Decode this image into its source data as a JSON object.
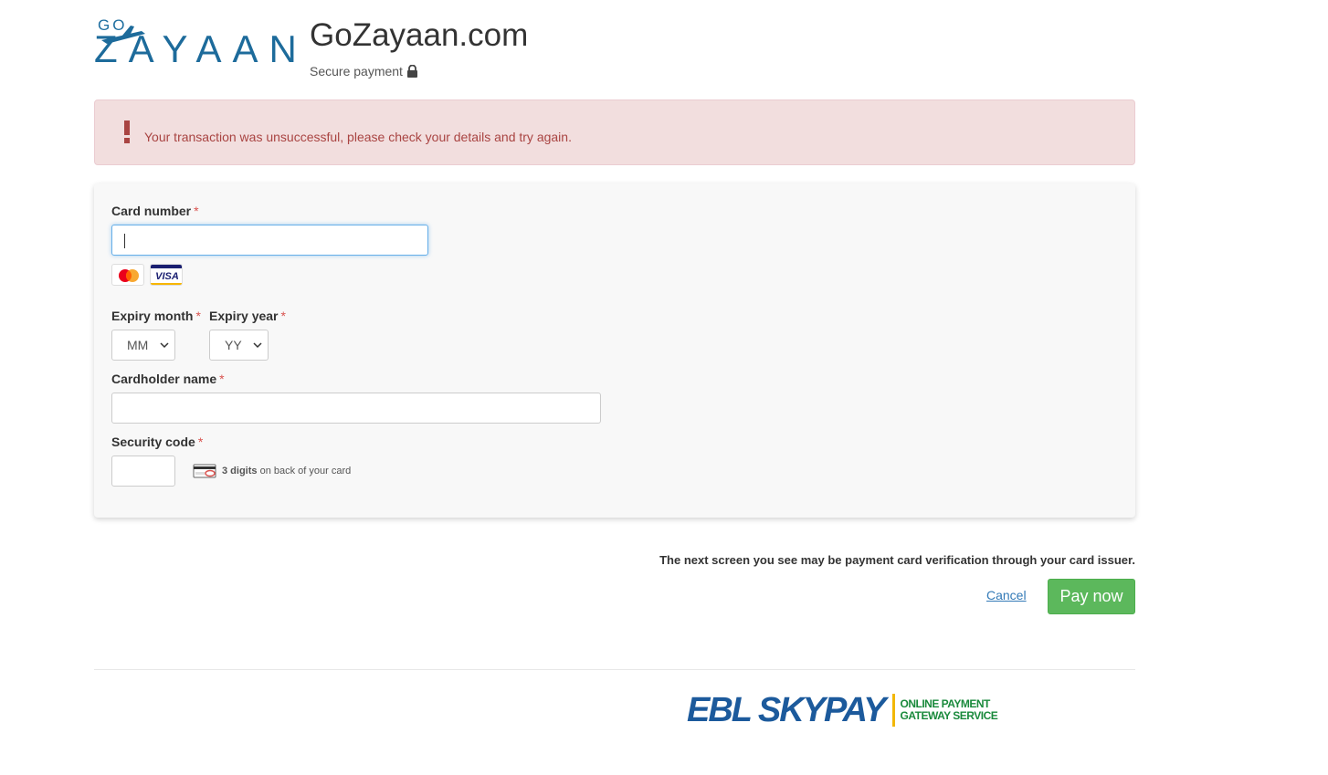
{
  "header": {
    "logo_small": "GO",
    "logo_word": "ZAYAAN",
    "site_title": "GoZayaan.com",
    "secure_label": "Secure payment"
  },
  "alert": {
    "icon": "exclamation-icon",
    "message": "Your transaction was unsuccessful, please check your details and try again.",
    "color": "#a94442"
  },
  "form": {
    "card_number": {
      "label": "Card number",
      "value": ""
    },
    "accepted_cards": [
      "mastercard-icon",
      "visa-icon"
    ],
    "visa_text": "VISA",
    "expiry_month": {
      "label": "Expiry month",
      "selected": "MM"
    },
    "expiry_year": {
      "label": "Expiry year",
      "selected": "YY"
    },
    "cardholder_name": {
      "label": "Cardholder name",
      "value": ""
    },
    "security_code": {
      "label": "Security code",
      "value": "",
      "hint_bold": "3 digits",
      "hint_rest": "on back of your card"
    },
    "required_marker": "*"
  },
  "footer": {
    "notice": "The next screen you see may be payment card verification through your card issuer.",
    "cancel_label": "Cancel",
    "pay_label": "Pay now",
    "pay_color": "#5cb85c",
    "provider_brand": "EBL SKYPAY",
    "provider_tag_line1": "ONLINE PAYMENT",
    "provider_tag_line2": "GATEWAY SERVICE"
  }
}
